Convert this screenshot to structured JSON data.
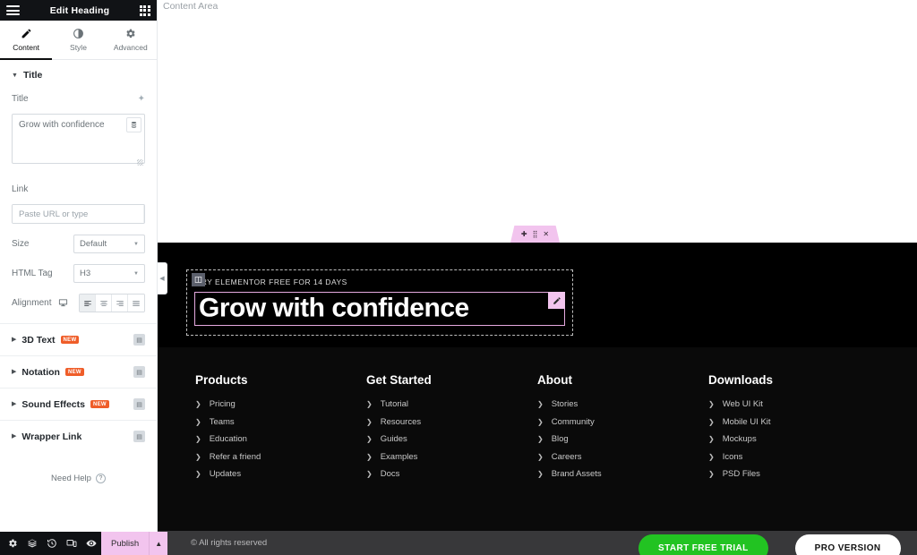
{
  "panel": {
    "header": {
      "title": "Edit Heading",
      "menu_icon": "hamburger-icon",
      "widgets_icon": "grid-icon"
    },
    "tabs": [
      {
        "label": "Content",
        "icon": "pencil-icon",
        "active": true
      },
      {
        "label": "Style",
        "icon": "contrast-icon",
        "active": false
      },
      {
        "label": "Advanced",
        "icon": "gear-icon",
        "active": false
      }
    ],
    "title_section": {
      "section_label": "Title",
      "title_label": "Title",
      "ai_icon": "sparkle-icon",
      "title_value": "Grow with confidence",
      "dynamic_tag_icon": "database-icon",
      "link_label": "Link",
      "link_placeholder": "Paste URL or type",
      "link_settings_icon": "gear-icon",
      "link_dynamic_icon": "database-icon",
      "size_label": "Size",
      "size_value": "Default",
      "html_tag_label": "HTML Tag",
      "html_tag_value": "H3",
      "alignment_label": "Alignment",
      "alignment_device_icon": "desktop-icon",
      "alignment_options": [
        "align-left",
        "align-center",
        "align-right",
        "align-justify"
      ],
      "alignment_selected": "align-left"
    },
    "collapsed_sections": [
      {
        "label": "3D Text",
        "badge": "NEW",
        "pro_icon": "pro-lock-icon"
      },
      {
        "label": "Notation",
        "badge": "NEW",
        "pro_icon": "pro-lock-icon"
      },
      {
        "label": "Sound Effects",
        "badge": "NEW",
        "pro_icon": "pro-lock-icon"
      },
      {
        "label": "Wrapper Link",
        "badge": "",
        "pro_icon": "pro-lock-icon"
      }
    ],
    "need_help": "Need Help",
    "footer": {
      "icons": [
        "settings-gear-icon",
        "navigator-layers-icon",
        "history-icon",
        "responsive-mode-icon",
        "preview-eye-icon"
      ],
      "publish_label": "Publish",
      "publish_caret_icon": "chevron-up-icon",
      "publish_color": "#f2c4ee"
    }
  },
  "canvas": {
    "content_area_label": "Content Area",
    "collapse_tab_icon": "chevron-left-icon",
    "section_handle": {
      "add_icon": "plus-icon",
      "drag_icon": "drag-dots-icon",
      "close_icon": "close-icon",
      "color": "#f2c4ee"
    },
    "hero": {
      "eyebrow": "TRY ELEMENTOR FREE FOR 14 DAYS",
      "column_handle_icon": "column-handle-icon",
      "heading": "Grow with confidence",
      "edit_handle_icon": "pencil-icon",
      "buttons": [
        {
          "label": "START FREE TRIAL",
          "style": "green",
          "color": "#22c322"
        },
        {
          "label": "PRO VERSION",
          "style": "white",
          "color": "#ffffff"
        }
      ]
    },
    "footer_columns": [
      {
        "title": "Products",
        "links": [
          "Pricing",
          "Teams",
          "Education",
          "Refer a friend",
          "Updates"
        ]
      },
      {
        "title": "Get Started",
        "links": [
          "Tutorial",
          "Resources",
          "Guides",
          "Examples",
          "Docs"
        ]
      },
      {
        "title": "About",
        "links": [
          "Stories",
          "Community",
          "Blog",
          "Careers",
          "Brand Assets"
        ]
      },
      {
        "title": "Downloads",
        "links": [
          "Web UI Kit",
          "Mobile UI Kit",
          "Mockups",
          "Icons",
          "PSD Files"
        ]
      }
    ],
    "copyright": "© All rights reserved"
  }
}
